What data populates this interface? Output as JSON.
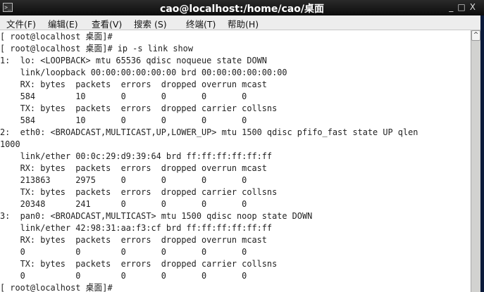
{
  "window": {
    "title": "cao@localhost:/home/cao/桌面",
    "icon": "terminal-icon",
    "controls": [
      "_",
      "□",
      "X"
    ]
  },
  "menu": [
    "文件(F)",
    "编辑(E)",
    "查看(V)",
    "搜索 (S)",
    "终端(T)",
    "帮助(H)"
  ],
  "terminal": {
    "lines": [
      "[ root@localhost 桌面]#",
      "[ root@localhost 桌面]# ip -s link show",
      "1:  lo: <LOOPBACK> mtu 65536 qdisc noqueue state DOWN",
      "    link/loopback 00:00:00:00:00:00 brd 00:00:00:00:00:00",
      "    RX: bytes  packets  errors  dropped overrun mcast",
      "    584        10       0       0       0       0",
      "    TX: bytes  packets  errors  dropped carrier collsns",
      "    584        10       0       0       0       0",
      "2:  eth0: <BROADCAST,MULTICAST,UP,LOWER_UP> mtu 1500 qdisc pfifo_fast state UP qlen",
      "1000",
      "    link/ether 00:0c:29:d9:39:64 brd ff:ff:ff:ff:ff:ff",
      "    RX: bytes  packets  errors  dropped overrun mcast",
      "    213863     2975     0       0       0       0",
      "    TX: bytes  packets  errors  dropped carrier collsns",
      "    20348      241      0       0       0       0",
      "3:  pan0: <BROADCAST,MULTICAST> mtu 1500 qdisc noop state DOWN",
      "    link/ether 42:98:31:aa:f3:cf brd ff:ff:ff:ff:ff:ff",
      "    RX: bytes  packets  errors  dropped overrun mcast",
      "    0          0        0       0       0       0",
      "    TX: bytes  packets  errors  dropped carrier collsns",
      "    0          0        0       0       0       0",
      "[ root@localhost 桌面]#"
    ]
  },
  "scrollbar": {
    "up_arrow": "^"
  }
}
